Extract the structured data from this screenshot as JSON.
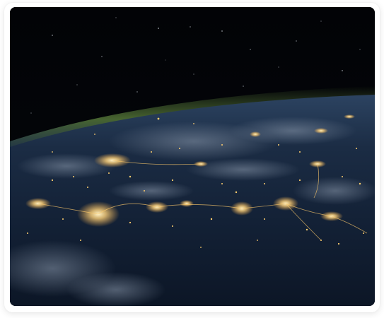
{
  "image": {
    "subject": "earth-at-night-city-lights",
    "colors": {
      "space": "#020408",
      "atmosphere": "#3d5a2a",
      "ocean": "#14243a",
      "city_light": "#ffd98a",
      "cloud": "#6f7f93"
    }
  }
}
